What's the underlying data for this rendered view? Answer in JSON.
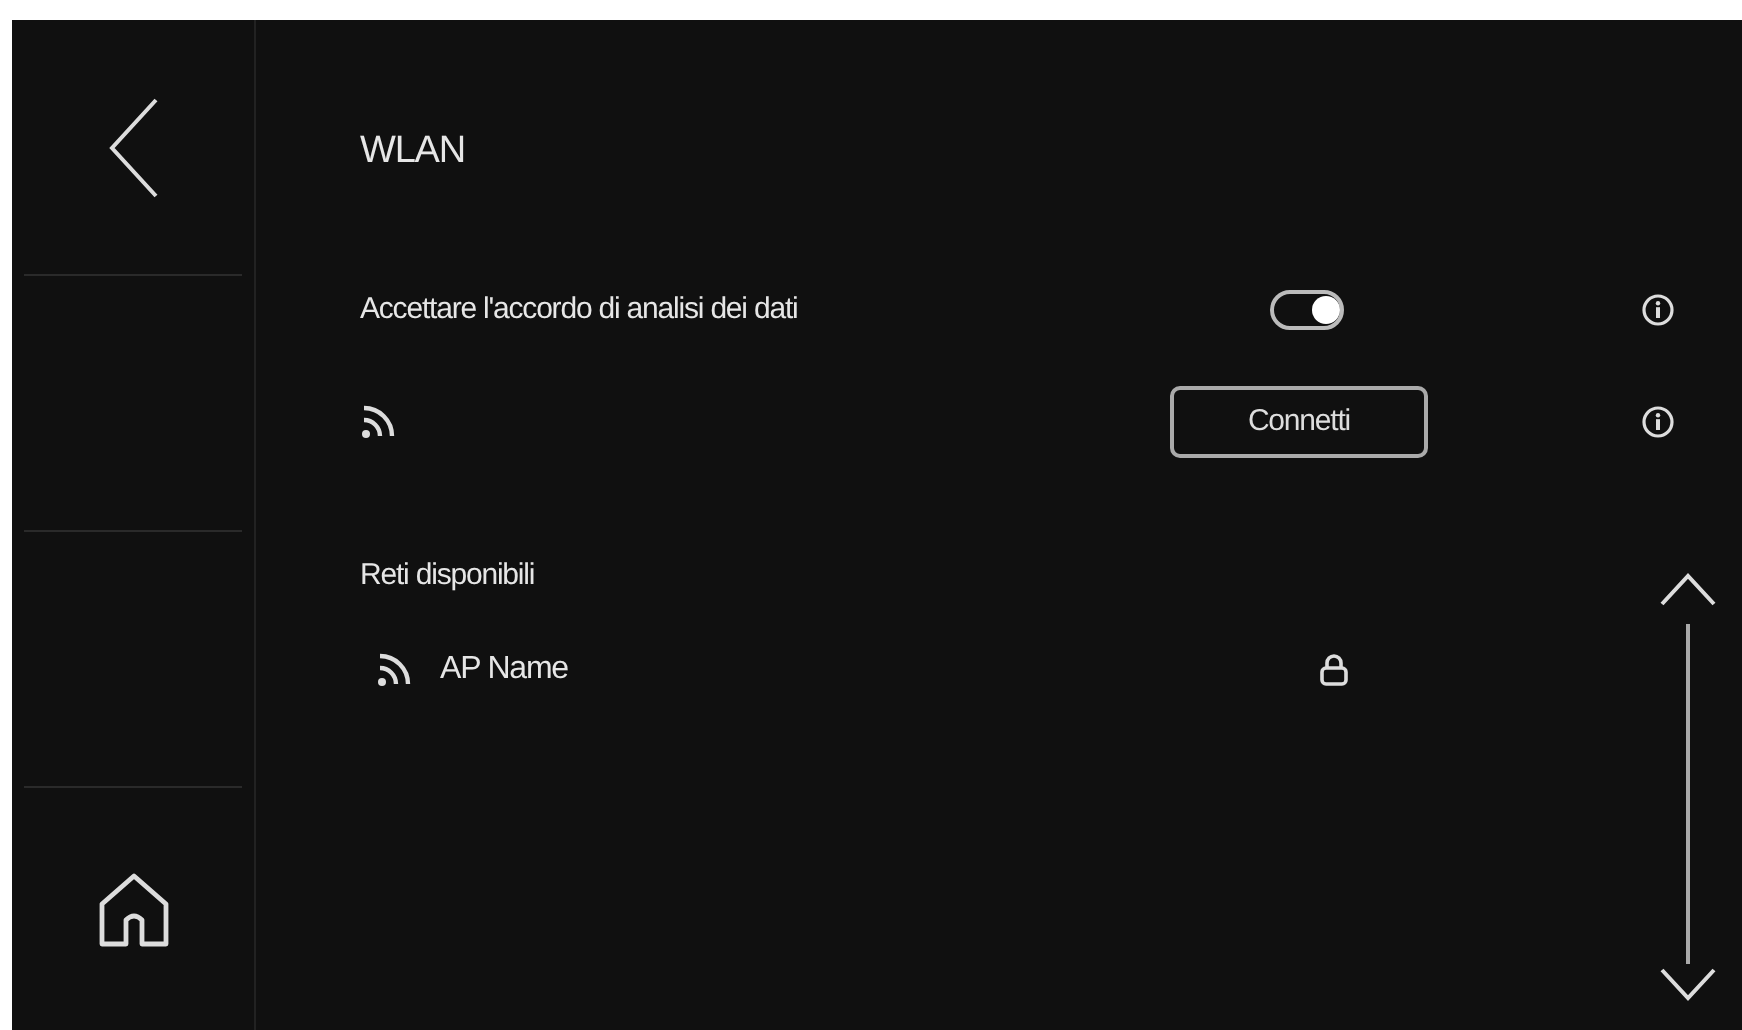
{
  "title": "WLAN",
  "settings": [
    {
      "kind": "toggle",
      "label": "Accettare l'accordo di analisi dei dati",
      "on": true
    },
    {
      "kind": "button",
      "button_label": "Connetti"
    }
  ],
  "networks_heading": "Reti disponibili",
  "networks": [
    {
      "name": "AP Name",
      "locked": true
    }
  ]
}
